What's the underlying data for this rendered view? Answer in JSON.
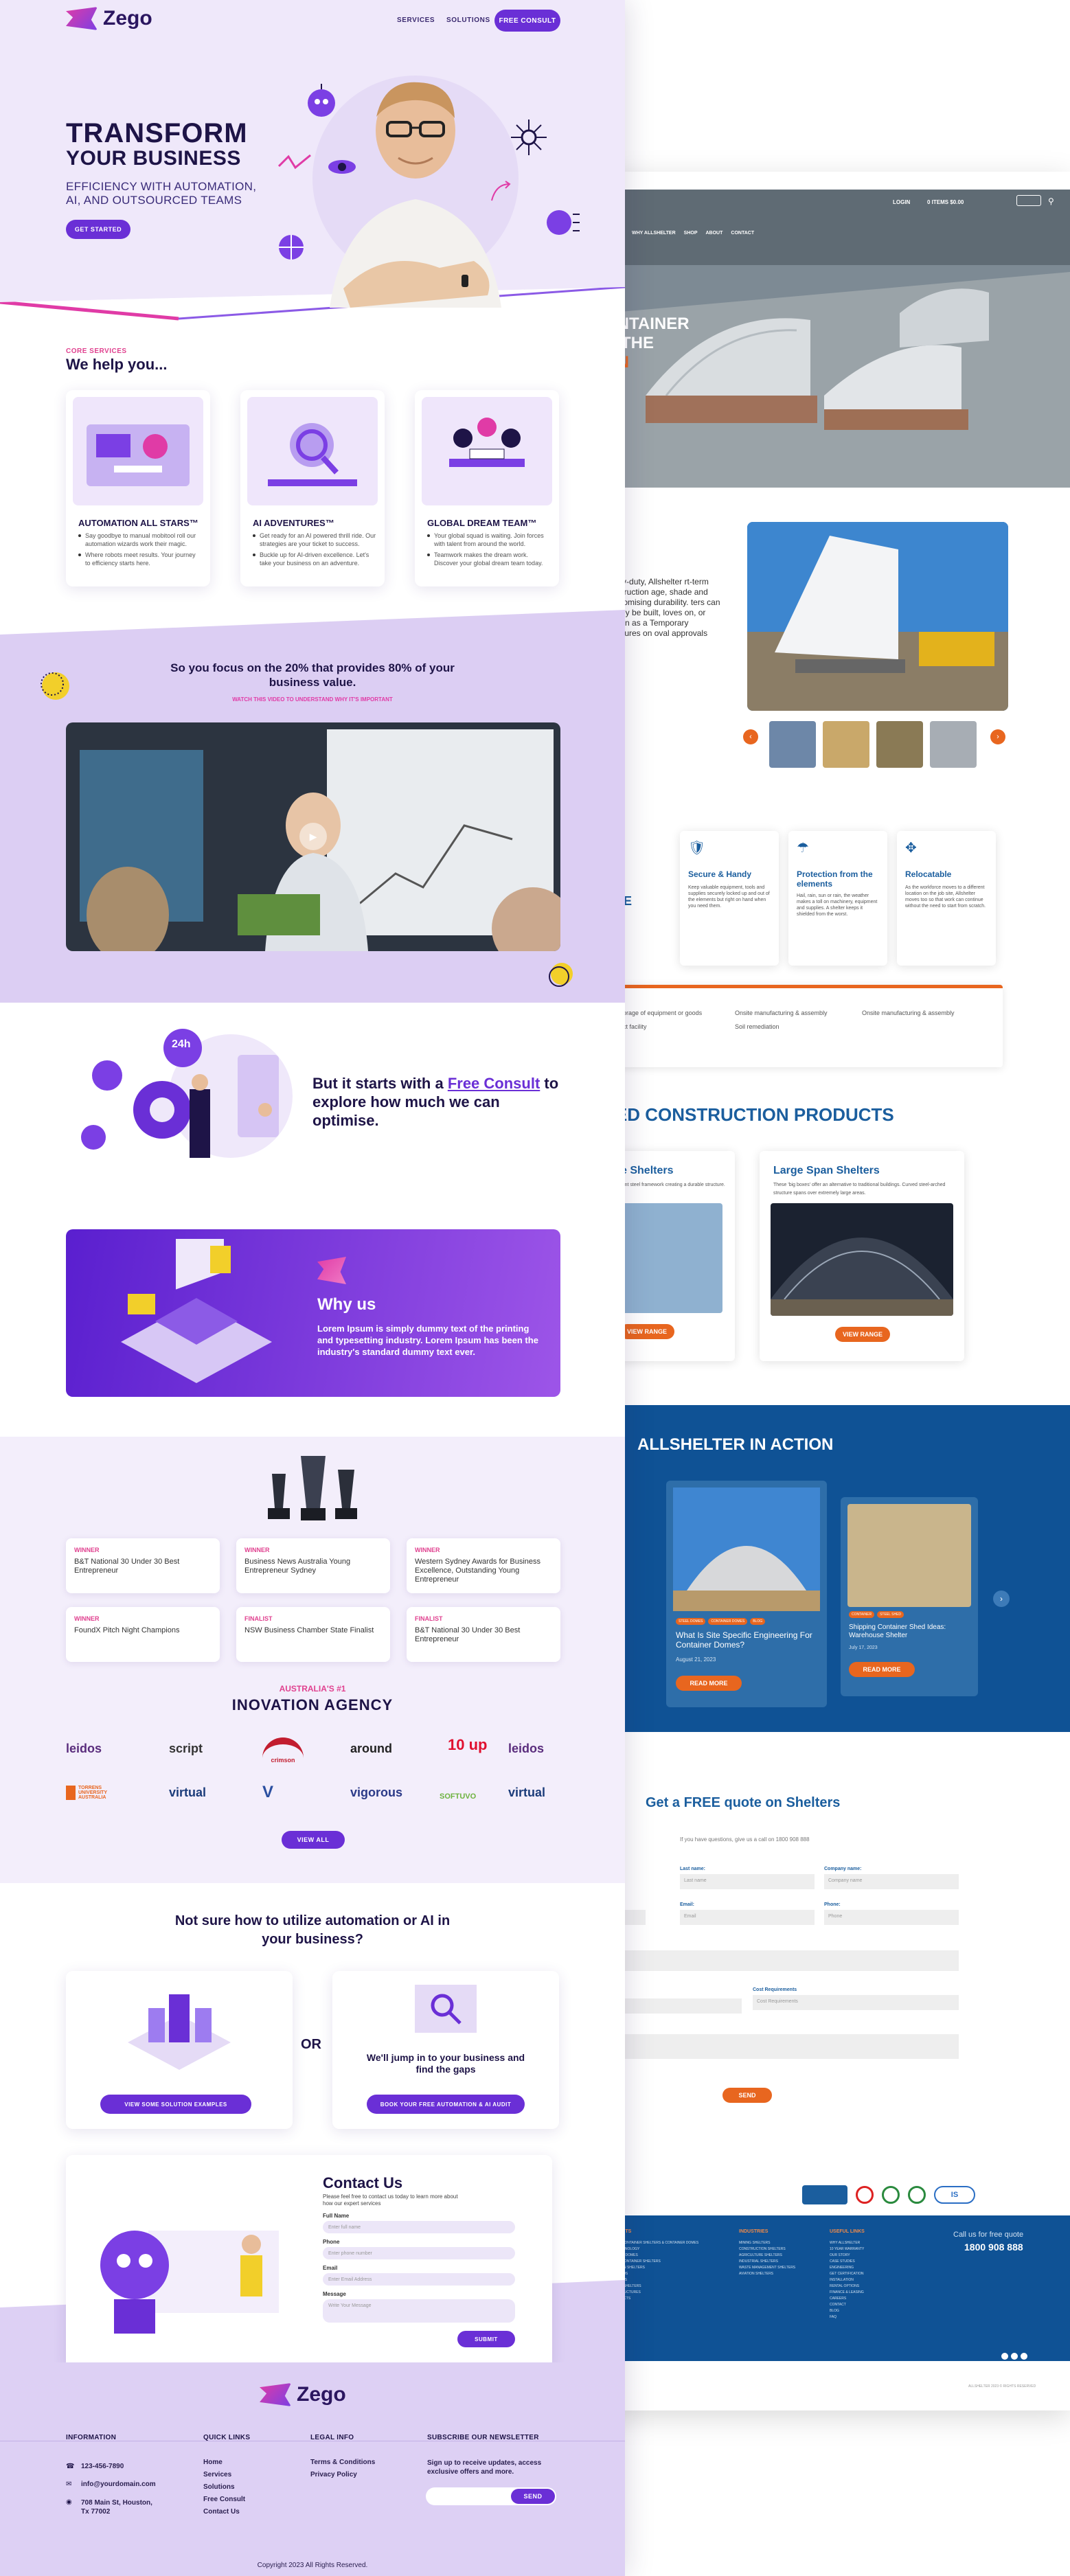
{
  "zego": {
    "brand": "Zego",
    "nav": {
      "services": "SERVICES",
      "solutions": "SOLUTIONS",
      "cta": "FREE CONSULT"
    },
    "hero": {
      "line1": "TRANSFORM",
      "line2": "YOUR BUSINESS",
      "subtitle": "EFFICIENCY WITH AUTOMATION, AI, AND OUTSOURCED TEAMS",
      "cta": "GET STARTED"
    },
    "services": {
      "kicker": "CORE SERVICES",
      "title": "We help you...",
      "cards": [
        {
          "title": "AUTOMATION ALL STARS™",
          "points": [
            "Say goodbye to manual mobitool roll our automation wizards work their magic.",
            "Where robots meet results. Your journey to efficiency starts here."
          ]
        },
        {
          "title": "AI ADVENTURES™",
          "points": [
            "Get ready for an AI powered thrill ride. Our strategies are your ticket to success.",
            "Buckle up for AI-driven excellence. Let's take your business on an adventure."
          ]
        },
        {
          "title": "GLOBAL DREAM TEAM™",
          "points": [
            "Your global squad is waiting. Join forces with talent from around the world.",
            "Teamwork makes the dream work. Discover your global dream team today."
          ]
        }
      ]
    },
    "focus": {
      "title": "So you focus on the 20% that provides 80% of your business value.",
      "kicker": "WATCH THIS VIDEO TO UNDERSTAND WHY IT'S IMPORTANT"
    },
    "consult": {
      "pre": "But it starts with a",
      "link": "Free Consult",
      "post": "to explore how much we can optimise.",
      "badge": "24h"
    },
    "why": {
      "title": "Why us",
      "body": "Lorem Ipsum is simply dummy text of the printing and typesetting industry. Lorem Ipsum has been the industry's standard dummy text ever."
    },
    "awards": [
      {
        "kicker": "WINNER",
        "text": "B&T National 30 Under 30 Best Entrepreneur"
      },
      {
        "kicker": "WINNER",
        "text": "Business News Australia Young Entrepreneur Sydney"
      },
      {
        "kicker": "WINNER",
        "text": "Western Sydney Awards for Business Excellence, Outstanding Young Entrepreneur"
      },
      {
        "kicker": "WINNER",
        "text": "FoundX Pitch Night Champions"
      },
      {
        "kicker": "FINALIST",
        "text": "NSW Business Chamber State Finalist"
      },
      {
        "kicker": "FINALIST",
        "text": "B&T National 30 Under 30 Best Entrepreneur"
      }
    ],
    "agency": {
      "kicker": "AUSTRALIA'S #1",
      "title": "INOVATION AGENCY",
      "view_all": "VIEW ALL"
    },
    "logos": [
      "leidos",
      "script",
      "crimson",
      "around",
      "10 up",
      "leidos",
      "TORRENS UNIVERSITY AUSTRALIA",
      "virtual",
      "V",
      "vigorous",
      "SOFTUVO",
      "virtual"
    ],
    "ai": {
      "title": "Not sure how to utilize automation or AI in your business?",
      "or": "OR",
      "right_text": "We'll jump in to your business and find the gaps",
      "btn_left": "VIEW SOME SOLUTION EXAMPLES",
      "btn_right": "BOOK YOUR FREE AUTOMATION & AI AUDIT"
    },
    "contact": {
      "title": "Contact Us",
      "intro": "Please feel free to contact us today to learn more about how our expert services",
      "fields": [
        {
          "label": "Full Name",
          "placeholder": "Enter full name"
        },
        {
          "label": "Phone",
          "placeholder": "Enter phone number"
        },
        {
          "label": "Email",
          "placeholder": "Enter Email Address"
        },
        {
          "label": "Message",
          "placeholder": "Write Your Message"
        }
      ],
      "submit": "SUBMIT"
    },
    "footer": {
      "information": "INFORMATION",
      "quick_links": "QUICK LINKS",
      "legal": "LEGAL INFO",
      "newsletter": "SUBSCRIBE OUR NEWSLETTER",
      "phone": "123-456-7890",
      "email": "info@yourdomain.com",
      "address": "708 Main St, Houston, Tx 77002",
      "links": [
        "Home",
        "Services",
        "Solutions",
        "Free Consult",
        "Contact Us"
      ],
      "legal_links": [
        "Terms & Conditions",
        "Privacy Policy"
      ],
      "newsletter_text": "Sign up to receive updates, access exclusive offers and more.",
      "send": "SEND",
      "copyright": "Copyright 2023 All Rights Reserved."
    }
  },
  "allshelter": {
    "topbar": {
      "login": "LOGIN",
      "cart": "0 ITEMS $0.00"
    },
    "nav": [
      "WHY ALLSHELTER",
      "SHOP",
      "ABOUT",
      "CONTACT"
    ],
    "hero": {
      "line1": "ONTAINER",
      "line2": "R THE",
      "line3": "ON"
    },
    "intro": "heavy-duty, Allshelter rt-term construction age, shade and ompromising durability. ters can quickly be built, loves on, or remain as a Temporary structures on oval approvals",
    "features": [
      {
        "title": "Secure & Handy",
        "text": "Keep valuable equipment, tools and supplies securely locked up and out of the elements but right on hand when you need them."
      },
      {
        "title": "Protection from the elements",
        "text": "Hail, rain, sun or rain, the weather makes a toll on machinery, equipment and supplies. A shelter keeps it shielded from the worst."
      },
      {
        "title": "Relocatable",
        "text": "As the workforce moves to a different location on the job site, Allshelter moves too so that work can continue without the need to start from scratch."
      }
    ],
    "site_word": "SITE",
    "uses": [
      "Bulk storage of equipment or goods",
      "Onsite manufacturing & assembly",
      "Onsite manufacturing & assembly",
      "Contract facility",
      "Soil remediation"
    ],
    "products_title": "TED CONSTRUCTION PRODUCTS",
    "products": [
      {
        "title": "ome Shelters",
        "text": "Convenient steel framework creating a durable structure.",
        "btn": "VIEW RANGE"
      },
      {
        "title": "Large Span Shelters",
        "text": "These 'big boxes' offer an alternative to traditional buildings. Curved steel-arched structure spans over extremely large areas.",
        "btn": "VIEW RANGE"
      }
    ],
    "action_title": "ALLSHELTER IN ACTION",
    "posts": [
      {
        "tags": [
          "STEEL DOMES",
          "CONTAINER DOMES",
          "BLOG"
        ],
        "title": "What Is Site Specific Engineering For Container Domes?",
        "date": "August 21, 2023",
        "btn": "READ MORE"
      },
      {
        "tags": [
          "CONTAINER",
          "STEEL SHED"
        ],
        "title": "Shipping Container Shed Ideas: Warehouse Shelter",
        "date": "July 17, 2023",
        "btn": "READ MORE"
      }
    ],
    "quote": {
      "title": "Get a FREE quote on Shelters",
      "sub": "If you have questions, give us a call on 1800 908 888",
      "fields": [
        {
          "label": "Last name:",
          "placeholder": "Last name"
        },
        {
          "label": "Company name:",
          "placeholder": "Company name"
        },
        {
          "label": "egion:",
          "placeholder": ""
        },
        {
          "label": "Email:",
          "placeholder": "Email"
        },
        {
          "label": "Phone:",
          "placeholder": "Phone"
        },
        {
          "label": "Cost Requirements",
          "placeholder": "Cost Requirements"
        }
      ],
      "btn": "SEND"
    },
    "footer": {
      "col1": "PRODUCTS",
      "col2": "INDUSTRIES",
      "col3": "USEFUL LINKS",
      "call": "Call us for free quote",
      "phone": "1800 908 888",
      "col1_links": [
        "STORAGE CONTAINER SHELTERS & CONTAINER DOMES",
        "DOME TECHNOLOGY",
        "CONTAINER DOMES",
        "SHIPPING CONTAINER SHELTERS",
        "LARGE SPAN SHELTERS",
        "STEEL SHEDS",
        "WORKSHOPS",
        "PORTABLE SHELTERS",
        "SHADE STRUCTURES",
        "ALL PRODUCTS"
      ],
      "col2_links": [
        "MINING SHELTERS",
        "CONSTRUCTION SHELTERS",
        "AGRICULTURE SHELTERS",
        "INDUSTRIAL SHELTERS",
        "WASTE MANAGEMENT SHELTERS",
        "AVIATION SHELTERS"
      ],
      "col3_links": [
        "WHY ALLSHELTER",
        "10 YEAR WARRANTY",
        "OUR STORY",
        "CASE STUDIES",
        "ENGINEERING",
        "GET CERTIFICATION",
        "INSTALLATION",
        "RENTAL OPTIONS",
        "FINANCE & LEASING",
        "CAREERS",
        "CONTACT",
        "BLOG",
        "FAQ"
      ],
      "copyright": "ALLSHELTER 2023 © RIGHTS RESERVED"
    }
  }
}
